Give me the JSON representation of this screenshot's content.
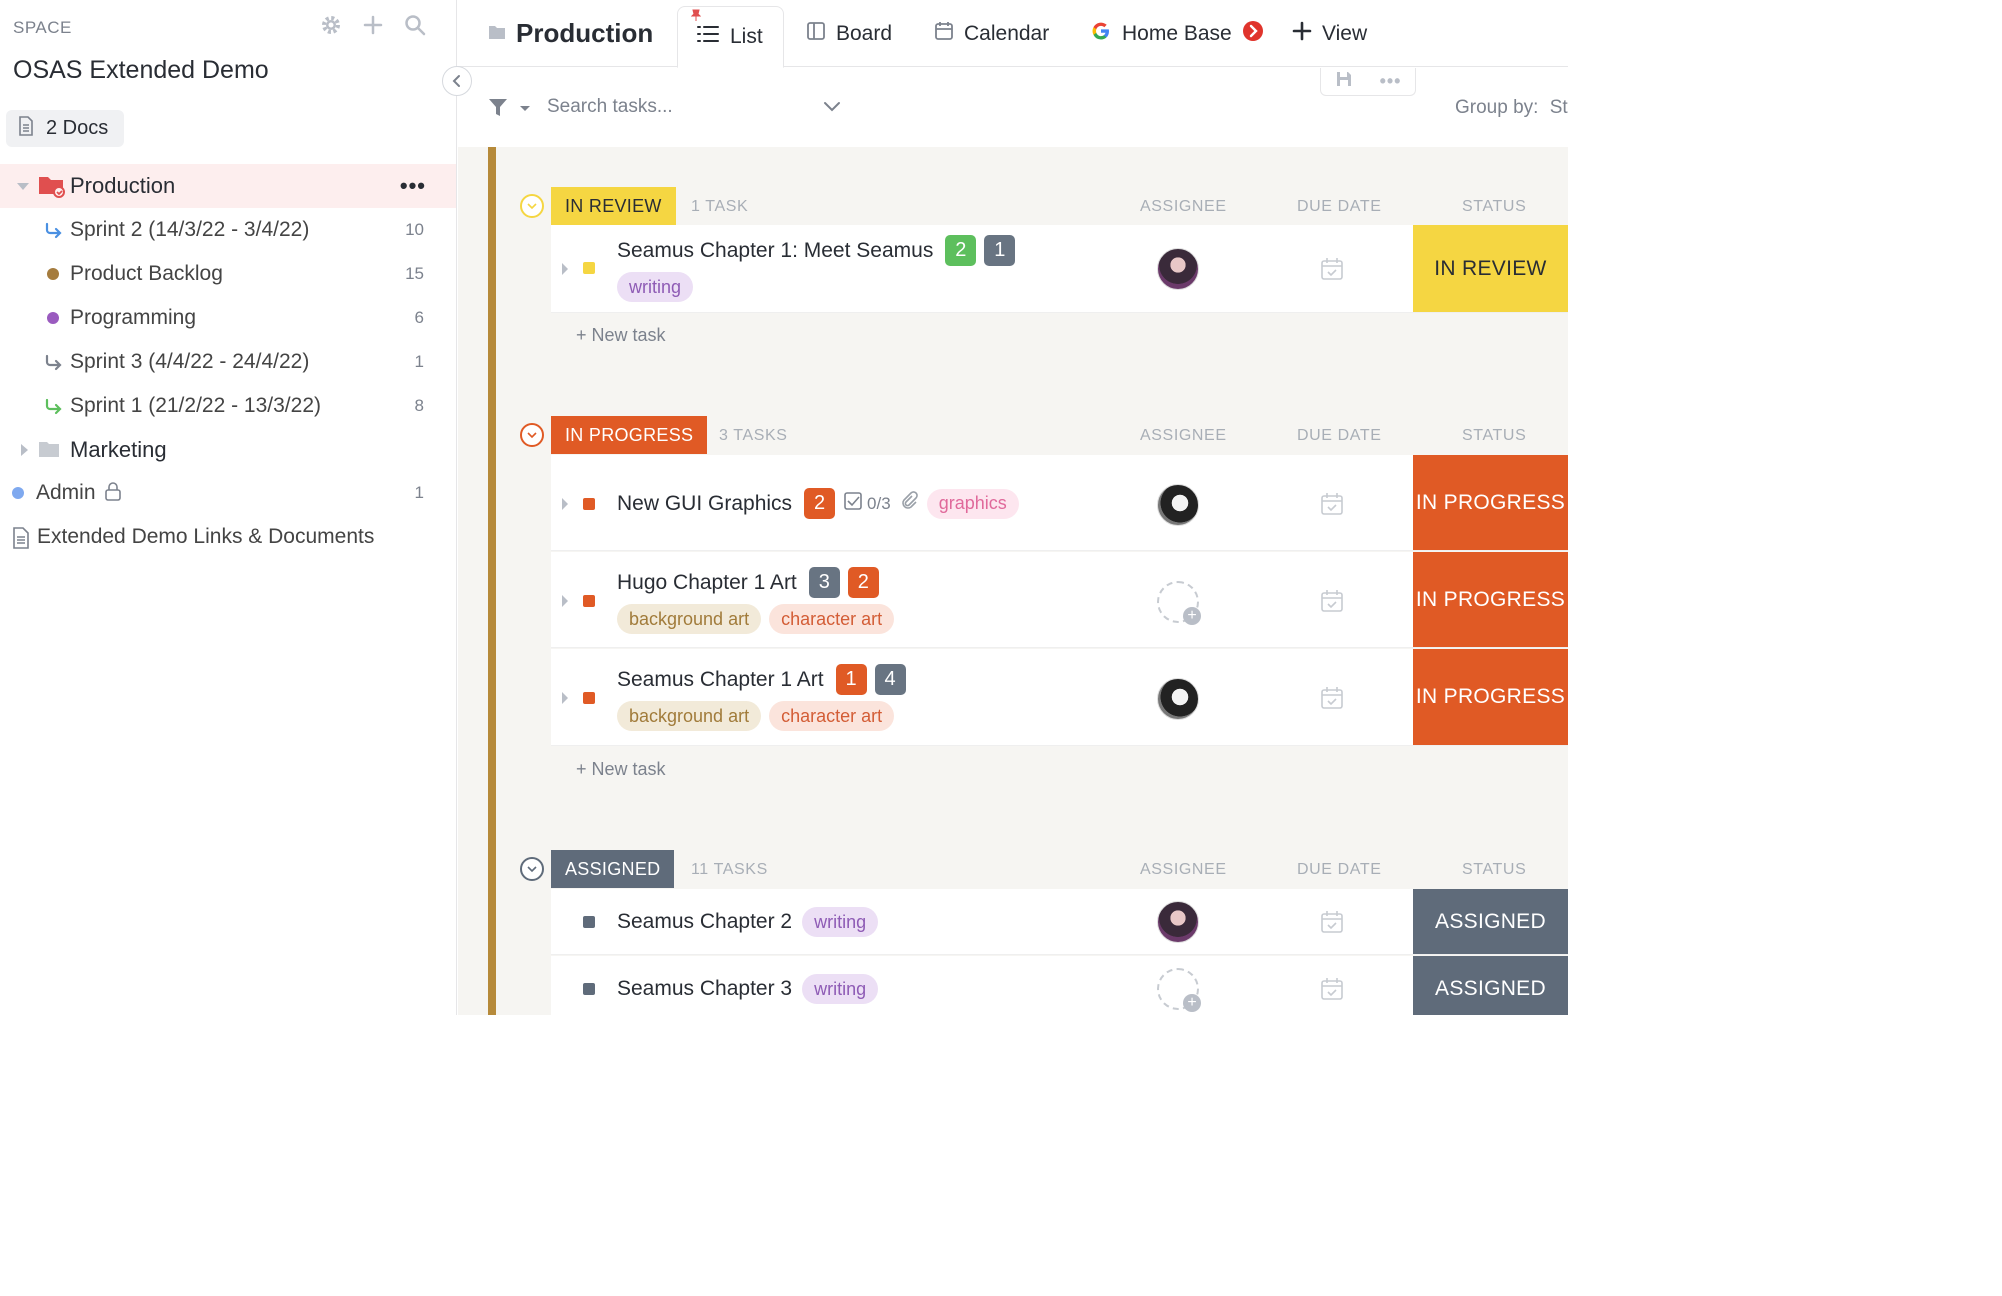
{
  "sidebar": {
    "space_label": "SPACE",
    "title": "OSAS Extended Demo",
    "docs_label": "2 Docs",
    "items": [
      {
        "label": "Production",
        "count": ""
      },
      {
        "label": "Sprint 2 (14/3/22 - 3/4/22)",
        "count": "10"
      },
      {
        "label": "Product Backlog",
        "count": "15"
      },
      {
        "label": "Programming",
        "count": "6"
      },
      {
        "label": "Sprint 3 (4/4/22 - 24/4/22)",
        "count": "1"
      },
      {
        "label": "Sprint 1 (21/2/22 - 13/3/22)",
        "count": "8"
      },
      {
        "label": "Marketing",
        "count": ""
      },
      {
        "label": "Admin",
        "count": "1"
      },
      {
        "label": "Extended Demo Links & Documents",
        "count": ""
      }
    ],
    "more_label": "•••"
  },
  "topbar": {
    "title": "Production",
    "tabs": [
      "List",
      "Board",
      "Calendar",
      "Home Base"
    ],
    "add_view_label": "View"
  },
  "search": {
    "placeholder": "Search tasks...",
    "group_by_label": "Group by:",
    "group_by_value": "St"
  },
  "columns": {
    "assignee": "ASSIGNEE",
    "due_date": "DUE DATE",
    "status": "STATUS"
  },
  "new_task_label": "+ New task",
  "groups": [
    {
      "label": "IN REVIEW",
      "count": "1 TASK",
      "color": "#f5d642",
      "text_color": "#292d34",
      "tasks": [
        {
          "name": "Seamus Chapter 1: Meet Seamus",
          "badges": [
            "2",
            "1"
          ],
          "tags": [
            "writing"
          ],
          "status": "IN REVIEW"
        }
      ]
    },
    {
      "label": "IN PROGRESS",
      "count": "3 TASKS",
      "color": "#e05a25",
      "text_color": "#ffffff",
      "tasks": [
        {
          "name": "New GUI Graphics",
          "badges": [
            "2"
          ],
          "checklist": "0/3",
          "tags": [
            "graphics"
          ],
          "status": "IN PROGRESS"
        },
        {
          "name": "Hugo Chapter 1 Art",
          "badges": [
            "3",
            "2"
          ],
          "tags": [
            "background art",
            "character art"
          ],
          "status": "IN PROGRESS"
        },
        {
          "name": "Seamus Chapter 1 Art",
          "badges": [
            "1",
            "4"
          ],
          "tags": [
            "background art",
            "character art"
          ],
          "status": "IN PROGRESS"
        }
      ]
    },
    {
      "label": "ASSIGNED",
      "count": "11 TASKS",
      "color": "#5f6b7a",
      "text_color": "#ffffff",
      "tasks": [
        {
          "name": "Seamus Chapter 2",
          "tags": [
            "writing"
          ],
          "status": "ASSIGNED"
        },
        {
          "name": "Seamus Chapter 3",
          "tags": [
            "writing"
          ],
          "status": "ASSIGNED"
        }
      ]
    }
  ],
  "colors": {
    "accent_production": "#e04f4f",
    "in_review": "#f5d642",
    "in_progress": "#e05a25",
    "assigned": "#5f6b7a",
    "green_badge": "#5dbf5d",
    "gray_badge": "#687482"
  }
}
